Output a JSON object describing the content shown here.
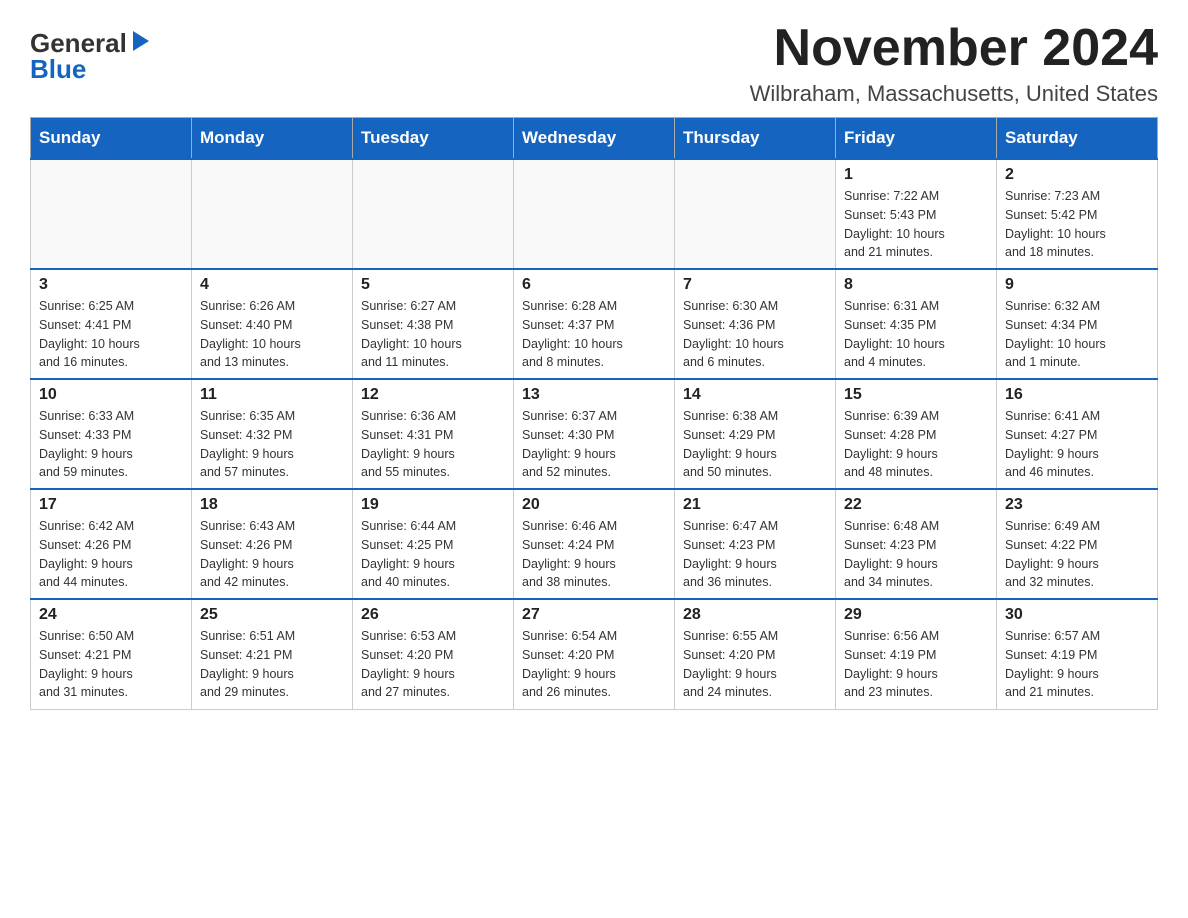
{
  "logo": {
    "general": "General",
    "blue": "Blue"
  },
  "title": "November 2024",
  "location": "Wilbraham, Massachusetts, United States",
  "days_of_week": [
    "Sunday",
    "Monday",
    "Tuesday",
    "Wednesday",
    "Thursday",
    "Friday",
    "Saturday"
  ],
  "weeks": [
    [
      {
        "day": "",
        "info": ""
      },
      {
        "day": "",
        "info": ""
      },
      {
        "day": "",
        "info": ""
      },
      {
        "day": "",
        "info": ""
      },
      {
        "day": "",
        "info": ""
      },
      {
        "day": "1",
        "info": "Sunrise: 7:22 AM\nSunset: 5:43 PM\nDaylight: 10 hours\nand 21 minutes."
      },
      {
        "day": "2",
        "info": "Sunrise: 7:23 AM\nSunset: 5:42 PM\nDaylight: 10 hours\nand 18 minutes."
      }
    ],
    [
      {
        "day": "3",
        "info": "Sunrise: 6:25 AM\nSunset: 4:41 PM\nDaylight: 10 hours\nand 16 minutes."
      },
      {
        "day": "4",
        "info": "Sunrise: 6:26 AM\nSunset: 4:40 PM\nDaylight: 10 hours\nand 13 minutes."
      },
      {
        "day": "5",
        "info": "Sunrise: 6:27 AM\nSunset: 4:38 PM\nDaylight: 10 hours\nand 11 minutes."
      },
      {
        "day": "6",
        "info": "Sunrise: 6:28 AM\nSunset: 4:37 PM\nDaylight: 10 hours\nand 8 minutes."
      },
      {
        "day": "7",
        "info": "Sunrise: 6:30 AM\nSunset: 4:36 PM\nDaylight: 10 hours\nand 6 minutes."
      },
      {
        "day": "8",
        "info": "Sunrise: 6:31 AM\nSunset: 4:35 PM\nDaylight: 10 hours\nand 4 minutes."
      },
      {
        "day": "9",
        "info": "Sunrise: 6:32 AM\nSunset: 4:34 PM\nDaylight: 10 hours\nand 1 minute."
      }
    ],
    [
      {
        "day": "10",
        "info": "Sunrise: 6:33 AM\nSunset: 4:33 PM\nDaylight: 9 hours\nand 59 minutes."
      },
      {
        "day": "11",
        "info": "Sunrise: 6:35 AM\nSunset: 4:32 PM\nDaylight: 9 hours\nand 57 minutes."
      },
      {
        "day": "12",
        "info": "Sunrise: 6:36 AM\nSunset: 4:31 PM\nDaylight: 9 hours\nand 55 minutes."
      },
      {
        "day": "13",
        "info": "Sunrise: 6:37 AM\nSunset: 4:30 PM\nDaylight: 9 hours\nand 52 minutes."
      },
      {
        "day": "14",
        "info": "Sunrise: 6:38 AM\nSunset: 4:29 PM\nDaylight: 9 hours\nand 50 minutes."
      },
      {
        "day": "15",
        "info": "Sunrise: 6:39 AM\nSunset: 4:28 PM\nDaylight: 9 hours\nand 48 minutes."
      },
      {
        "day": "16",
        "info": "Sunrise: 6:41 AM\nSunset: 4:27 PM\nDaylight: 9 hours\nand 46 minutes."
      }
    ],
    [
      {
        "day": "17",
        "info": "Sunrise: 6:42 AM\nSunset: 4:26 PM\nDaylight: 9 hours\nand 44 minutes."
      },
      {
        "day": "18",
        "info": "Sunrise: 6:43 AM\nSunset: 4:26 PM\nDaylight: 9 hours\nand 42 minutes."
      },
      {
        "day": "19",
        "info": "Sunrise: 6:44 AM\nSunset: 4:25 PM\nDaylight: 9 hours\nand 40 minutes."
      },
      {
        "day": "20",
        "info": "Sunrise: 6:46 AM\nSunset: 4:24 PM\nDaylight: 9 hours\nand 38 minutes."
      },
      {
        "day": "21",
        "info": "Sunrise: 6:47 AM\nSunset: 4:23 PM\nDaylight: 9 hours\nand 36 minutes."
      },
      {
        "day": "22",
        "info": "Sunrise: 6:48 AM\nSunset: 4:23 PM\nDaylight: 9 hours\nand 34 minutes."
      },
      {
        "day": "23",
        "info": "Sunrise: 6:49 AM\nSunset: 4:22 PM\nDaylight: 9 hours\nand 32 minutes."
      }
    ],
    [
      {
        "day": "24",
        "info": "Sunrise: 6:50 AM\nSunset: 4:21 PM\nDaylight: 9 hours\nand 31 minutes."
      },
      {
        "day": "25",
        "info": "Sunrise: 6:51 AM\nSunset: 4:21 PM\nDaylight: 9 hours\nand 29 minutes."
      },
      {
        "day": "26",
        "info": "Sunrise: 6:53 AM\nSunset: 4:20 PM\nDaylight: 9 hours\nand 27 minutes."
      },
      {
        "day": "27",
        "info": "Sunrise: 6:54 AM\nSunset: 4:20 PM\nDaylight: 9 hours\nand 26 minutes."
      },
      {
        "day": "28",
        "info": "Sunrise: 6:55 AM\nSunset: 4:20 PM\nDaylight: 9 hours\nand 24 minutes."
      },
      {
        "day": "29",
        "info": "Sunrise: 6:56 AM\nSunset: 4:19 PM\nDaylight: 9 hours\nand 23 minutes."
      },
      {
        "day": "30",
        "info": "Sunrise: 6:57 AM\nSunset: 4:19 PM\nDaylight: 9 hours\nand 21 minutes."
      }
    ]
  ],
  "colors": {
    "header_bg": "#1565C0",
    "header_text": "#ffffff",
    "border": "#cccccc",
    "text": "#333333"
  }
}
